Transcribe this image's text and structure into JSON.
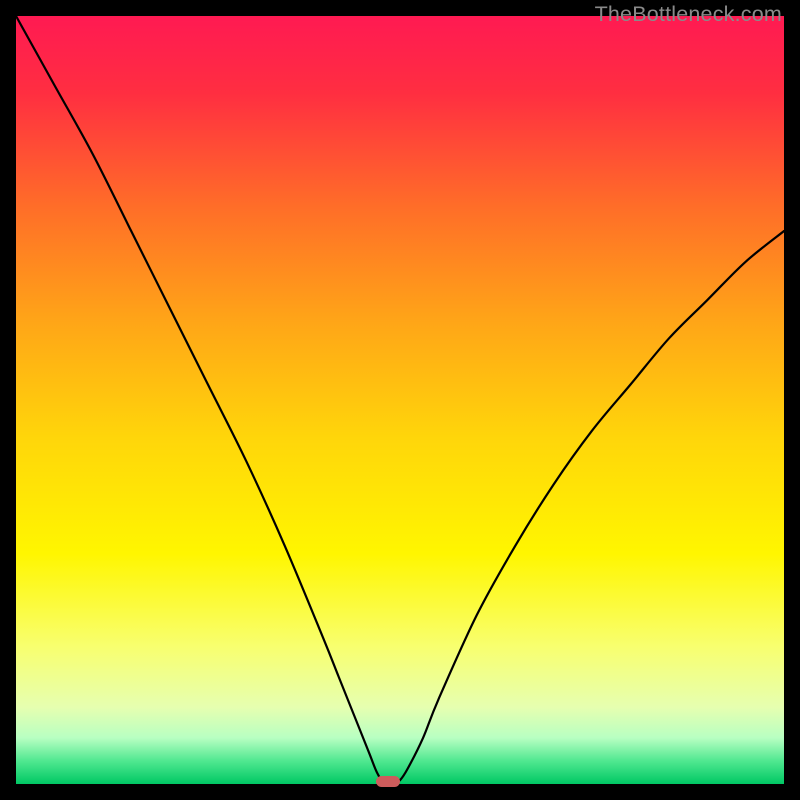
{
  "watermark": {
    "text": "TheBottleneck.com"
  },
  "chart_data": {
    "type": "line",
    "title": "",
    "xlabel": "",
    "ylabel": "",
    "xlim": [
      0,
      100
    ],
    "ylim": [
      0,
      100
    ],
    "grid": false,
    "legend": false,
    "x": [
      0,
      5,
      10,
      15,
      20,
      25,
      30,
      35,
      40,
      42,
      44,
      46,
      47,
      48,
      49,
      50,
      51,
      53,
      55,
      60,
      65,
      70,
      75,
      80,
      85,
      90,
      95,
      100
    ],
    "values": [
      100,
      91,
      82,
      72,
      62,
      52,
      42,
      31,
      19,
      14,
      9,
      4,
      1.5,
      0,
      0,
      0.5,
      2,
      6,
      11,
      22,
      31,
      39,
      46,
      52,
      58,
      63,
      68,
      72
    ],
    "marker": {
      "x": 48.5,
      "y": 0.3,
      "color": "#cd5c5c",
      "shape": "pill"
    },
    "background_gradient": {
      "stops": [
        {
          "pos": 0.0,
          "color": "#ff1a52"
        },
        {
          "pos": 0.1,
          "color": "#ff2e41"
        },
        {
          "pos": 0.25,
          "color": "#ff6e28"
        },
        {
          "pos": 0.4,
          "color": "#ffa617"
        },
        {
          "pos": 0.55,
          "color": "#ffd60a"
        },
        {
          "pos": 0.7,
          "color": "#fff600"
        },
        {
          "pos": 0.82,
          "color": "#f8ff6e"
        },
        {
          "pos": 0.9,
          "color": "#e6ffb0"
        },
        {
          "pos": 0.94,
          "color": "#b8ffc2"
        },
        {
          "pos": 0.97,
          "color": "#50e890"
        },
        {
          "pos": 1.0,
          "color": "#00c864"
        }
      ]
    }
  }
}
